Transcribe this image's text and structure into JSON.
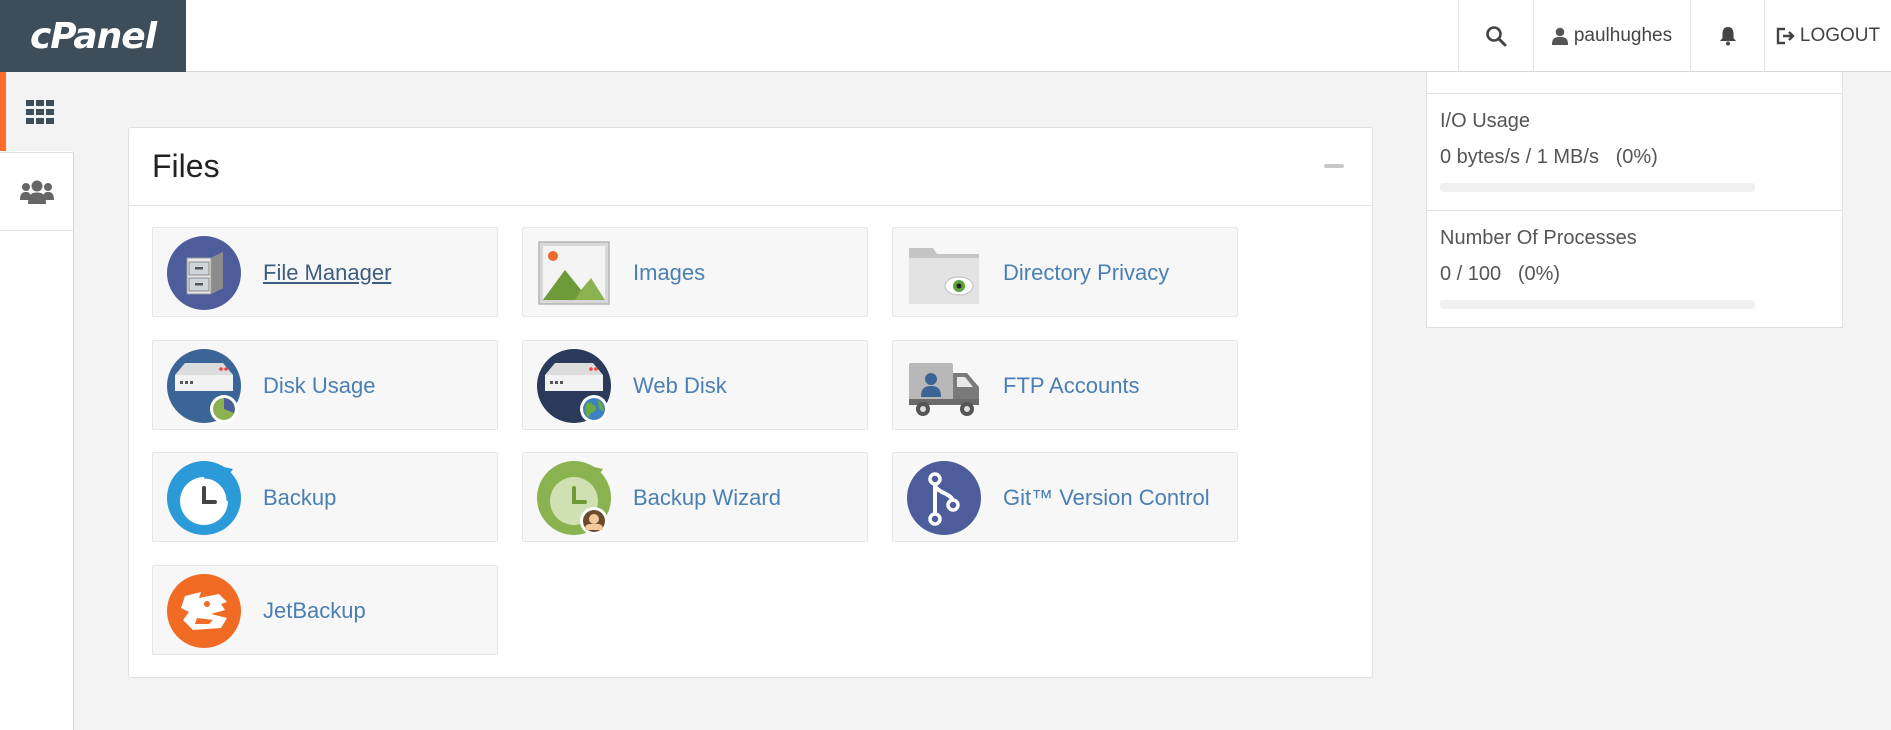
{
  "header": {
    "logo_text": "cPanel",
    "username": "paulhughes",
    "logout_label": "LOGOUT"
  },
  "files": {
    "title": "Files",
    "items": [
      {
        "label": "File Manager",
        "icon": "file-manager-icon"
      },
      {
        "label": "Images",
        "icon": "images-icon"
      },
      {
        "label": "Directory Privacy",
        "icon": "directory-privacy-icon"
      },
      {
        "label": "Disk Usage",
        "icon": "disk-usage-icon"
      },
      {
        "label": "Web Disk",
        "icon": "web-disk-icon"
      },
      {
        "label": "FTP Accounts",
        "icon": "ftp-accounts-icon"
      },
      {
        "label": "Backup",
        "icon": "backup-icon"
      },
      {
        "label": "Backup Wizard",
        "icon": "backup-wizard-icon"
      },
      {
        "label": "Git™ Version Control",
        "icon": "git-icon"
      },
      {
        "label": "JetBackup",
        "icon": "jetbackup-icon"
      }
    ]
  },
  "stats": {
    "io_usage": {
      "title": "I/O Usage",
      "value": "0 bytes/s / 1 MB/s   (0%)",
      "percent": 0
    },
    "processes": {
      "title": "Number Of Processes",
      "value": "0 / 100   (0%)",
      "percent": 0
    }
  },
  "colors": {
    "brand": "#3e4d5a",
    "accent": "#ff6c2c",
    "link": "#4a7fb5"
  }
}
